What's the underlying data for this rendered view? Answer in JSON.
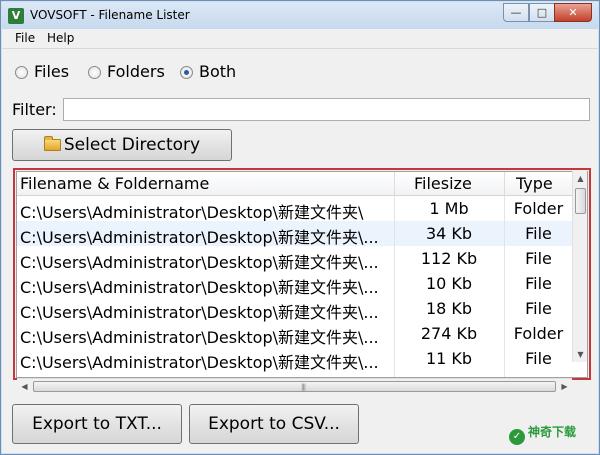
{
  "window": {
    "title": "VOVSOFT - Filename Lister",
    "buttons": {
      "minimize": "—",
      "maximize": "□",
      "close": "✕"
    }
  },
  "menu": [
    "File",
    "Help"
  ],
  "options": {
    "items": [
      "Files",
      "Folders",
      "Both"
    ],
    "selected": "Both"
  },
  "filter": {
    "label": "Filter:",
    "value": ""
  },
  "select_directory": {
    "label": "Select Directory",
    "icon": "folder-icon"
  },
  "table": {
    "columns": [
      "Filename & Foldername",
      "Filesize",
      "Type"
    ],
    "rows": [
      {
        "name": "C:\\Users\\Administrator\\Desktop\\新建文件夹\\",
        "size": "1 Mb",
        "type": "Folder"
      },
      {
        "name": "C:\\Users\\Administrator\\Desktop\\新建文件夹\\...",
        "size": "34 Kb",
        "type": "File"
      },
      {
        "name": "C:\\Users\\Administrator\\Desktop\\新建文件夹\\...",
        "size": "112 Kb",
        "type": "File"
      },
      {
        "name": "C:\\Users\\Administrator\\Desktop\\新建文件夹\\...",
        "size": "10 Kb",
        "type": "File"
      },
      {
        "name": "C:\\Users\\Administrator\\Desktop\\新建文件夹\\...",
        "size": "18 Kb",
        "type": "File"
      },
      {
        "name": "C:\\Users\\Administrator\\Desktop\\新建文件夹\\...",
        "size": "274 Kb",
        "type": "Folder"
      },
      {
        "name": "C:\\Users\\Administrator\\Desktop\\新建文件夹\\...",
        "size": "11 Kb",
        "type": "File"
      }
    ]
  },
  "export": {
    "txt_label": "Export to TXT...",
    "csv_label": "Export to CSV..."
  },
  "watermark": "神奇下载",
  "colors": {
    "highlight_border": "#c4373d",
    "selected_row": "#ebf3fc",
    "window_bg": "#f0f0f0"
  }
}
